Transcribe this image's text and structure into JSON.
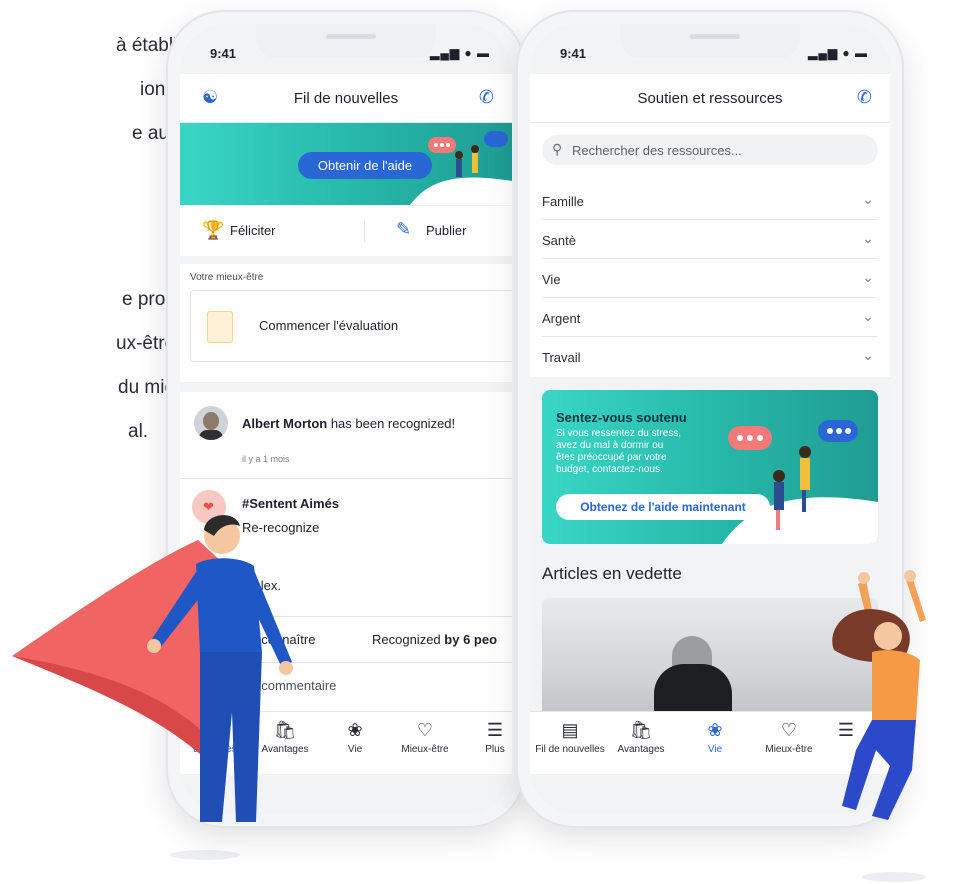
{
  "background_text": [
    "à établie, la",
    "ion",
    "e aux",
    "e propose",
    "ux-être des",
    "du mieux",
    "al."
  ],
  "phone_left": {
    "status_time": "9:41",
    "status_icons": "▂▄▆ ● ▬",
    "header_title": "Fil de nouvelles",
    "banner_button": "Obtenir de l'aide",
    "actions": {
      "congratulate": "Féliciter",
      "publish": "Publier"
    },
    "wellness_label": "Votre mieux-être",
    "start_eval": "Commencer l'évaluation",
    "post": {
      "author": "Albert Morton",
      "author_suffix": " has been recognized!",
      "time": "il y a 1 mois",
      "hashtag": "#Sentent Aimés",
      "line1": "Re-recognize",
      "signature": "– Alex.",
      "recognize": "econnaître",
      "recognized_prefix": "Recognized ",
      "recognized_bold": "by 6 peo",
      "comment_placeholder": "re un commentaire"
    },
    "tabs": [
      "de nou",
      "Avantages",
      "Vie",
      "Mieux-être",
      "Plus"
    ],
    "tabs_extra": "les"
  },
  "phone_right": {
    "status_time": "9:41",
    "status_icons": "▂▄▆ ● ▬",
    "header_title": "Soutien et ressources",
    "search_placeholder": "Rechercher des ressources...",
    "categories": [
      "Famille",
      "Santè",
      "Vie",
      "Argent",
      "Travail"
    ],
    "support_card": {
      "title": "Sentez-vous soutenu",
      "body": [
        "Si vous ressentez du stress,",
        "avez du mal à dormir ou",
        "êtes préoccupé par votre",
        "budget, contactez-nous."
      ],
      "button": "Obtenez de l'aide maintenant"
    },
    "featured_title": "Articles en vedette",
    "tabs": [
      "Fil de nouvelles",
      "Avantages",
      "Vie",
      "Mieux-être"
    ]
  },
  "colors": {
    "accent": "#2a67d6",
    "teal": "#2cc3b4",
    "cape": "#f06060",
    "hero_blue": "#1f57c7",
    "woman_orange": "#f59a45"
  }
}
